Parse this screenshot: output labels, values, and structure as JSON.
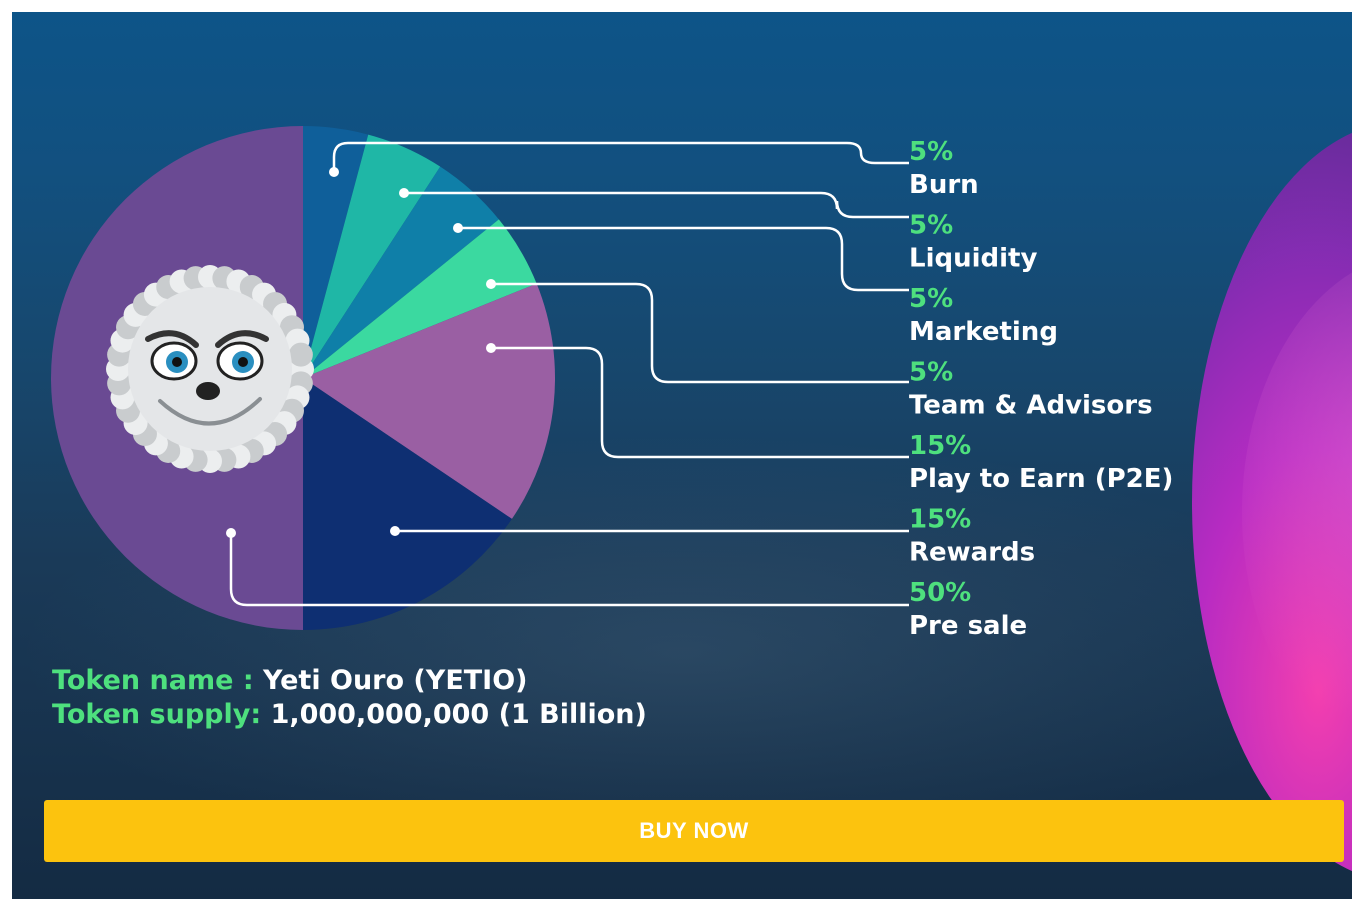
{
  "chart_data": {
    "type": "pie",
    "slices": [
      {
        "pct_label": "5%",
        "label": "Burn",
        "value": 5,
        "color": "#0f5f9a"
      },
      {
        "pct_label": "5%",
        "label": "Liquidity",
        "value": 5,
        "color": "#1fb7a6"
      },
      {
        "pct_label": "5%",
        "label": "Marketing",
        "value": 5,
        "color": "#0f7fa8"
      },
      {
        "pct_label": "5%",
        "label": "Team & Advisors",
        "value": 5,
        "color": "#3bd9a0"
      },
      {
        "pct_label": "15%",
        "label": "Play to Earn (P2E)",
        "value": 15,
        "color": "#9a5fa3"
      },
      {
        "pct_label": "15%",
        "label": "Rewards",
        "value": 15,
        "color": "#0e2f72"
      },
      {
        "pct_label": "50%",
        "label": "Pre sale",
        "value": 50,
        "color": "#6a4a93"
      }
    ],
    "legend_position": "right",
    "center_image": "yeti mascot"
  },
  "token": {
    "name_key": "Token name :",
    "name_value": "Yeti Ouro (YETIO)",
    "supply_key": "Token supply:",
    "supply_value": "1,000,000,000 (1 Billion)"
  },
  "buy_button": {
    "label": "BUY NOW",
    "color": "#fcc30e"
  },
  "colors": {
    "accent_green": "#4ee07e",
    "background": "#17476d"
  }
}
